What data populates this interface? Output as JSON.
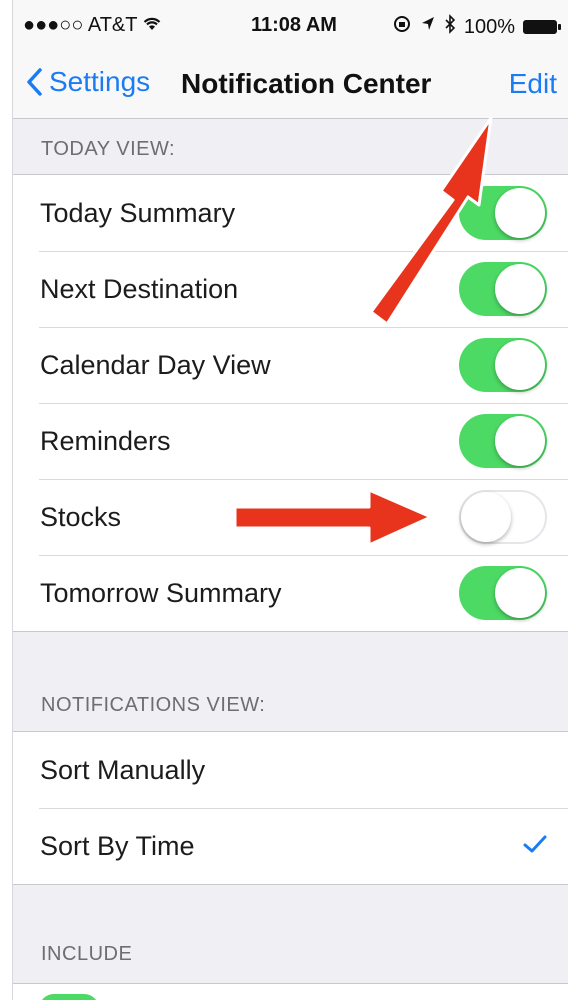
{
  "status_bar": {
    "carrier": "●●●○○ AT&T",
    "time": "11:08 AM",
    "battery": "100%"
  },
  "nav": {
    "back_label": "Settings",
    "title": "Notification Center",
    "edit_label": "Edit"
  },
  "today_view": {
    "header": "TODAY VIEW:",
    "items": [
      {
        "label": "Today Summary",
        "on": true
      },
      {
        "label": "Next Destination",
        "on": true
      },
      {
        "label": "Calendar Day View",
        "on": true
      },
      {
        "label": "Reminders",
        "on": true
      },
      {
        "label": "Stocks",
        "on": false
      },
      {
        "label": "Tomorrow Summary",
        "on": true
      }
    ]
  },
  "notifications_view": {
    "header": "NOTIFICATIONS VIEW:",
    "items": [
      {
        "label": "Sort Manually",
        "checked": false
      },
      {
        "label": "Sort By Time",
        "checked": true
      }
    ]
  },
  "include": {
    "header": "INCLUDE"
  },
  "colors": {
    "accent": "#1a7cf5",
    "toggle_on": "#4cd964",
    "annotation_arrow": "#e8341c"
  }
}
